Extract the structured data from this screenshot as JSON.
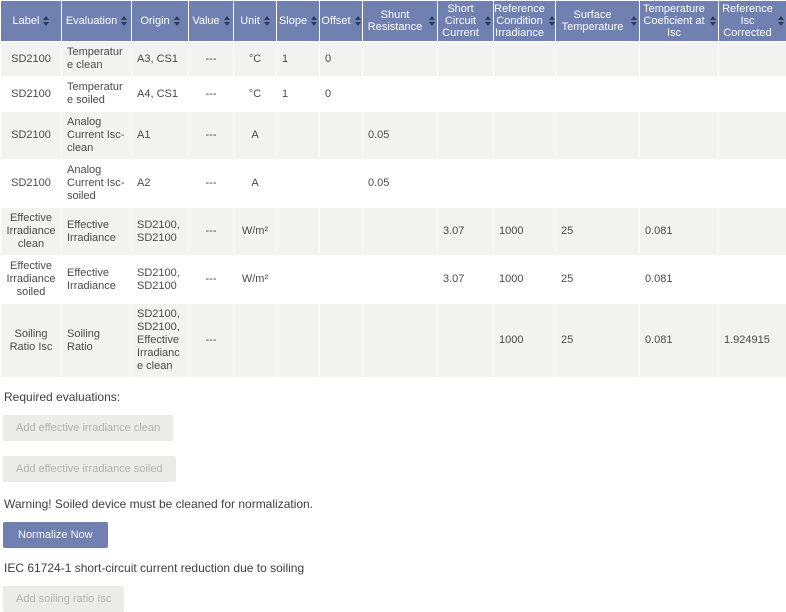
{
  "table": {
    "columns": [
      {
        "key": "label",
        "label": "Label"
      },
      {
        "key": "evaluation",
        "label": "Evaluation"
      },
      {
        "key": "origin",
        "label": "Origin"
      },
      {
        "key": "value",
        "label": "Value"
      },
      {
        "key": "unit",
        "label": "Unit"
      },
      {
        "key": "slope",
        "label": "Slope"
      },
      {
        "key": "offset",
        "label": "Offset"
      },
      {
        "key": "shunt_resistance",
        "label": "Shunt Resistance"
      },
      {
        "key": "short_circuit_current",
        "label": "Short Circuit Current"
      },
      {
        "key": "reference_condition_irradiance",
        "label": "Reference Condition Irradiance"
      },
      {
        "key": "surface_temperature",
        "label": "Surface Temperature"
      },
      {
        "key": "temperature_coeficient_at_isc",
        "label": "Temperature Coeficient at Isc"
      },
      {
        "key": "reference_isc_corrected",
        "label": "Reference Isc Corrected"
      }
    ],
    "rows": [
      [
        "SD2100",
        "Temperature clean",
        "A3, CS1",
        "---",
        "°C",
        "1",
        "0",
        "",
        "",
        "",
        "",
        "",
        ""
      ],
      [
        "SD2100",
        "Temperature soiled",
        "A4, CS1",
        "---",
        "°C",
        "1",
        "0",
        "",
        "",
        "",
        "",
        "",
        ""
      ],
      [
        "SD2100",
        "Analog Current Isc-clean",
        "A1",
        "---",
        "A",
        "",
        "",
        "0.05",
        "",
        "",
        "",
        "",
        ""
      ],
      [
        "SD2100",
        "Analog Current Isc-soiled",
        "A2",
        "---",
        "A",
        "",
        "",
        "0.05",
        "",
        "",
        "",
        "",
        ""
      ],
      [
        "Effective Irradiance clean",
        "Effective Irradiance",
        "SD2100, SD2100",
        "---",
        "W/m²",
        "",
        "",
        "",
        "3.07",
        "1000",
        "25",
        "0.081",
        ""
      ],
      [
        "Effective Irradiance soiled",
        "Effective Irradiance",
        "SD2100, SD2100",
        "---",
        "W/m²",
        "",
        "",
        "",
        "3.07",
        "1000",
        "25",
        "0.081",
        ""
      ],
      [
        "Soiling Ratio Isc",
        "Soiling Ratio",
        "SD2100, SD2100, Effective Irradiance clean",
        "---",
        "",
        "",
        "",
        "",
        "",
        "1000",
        "25",
        "0.081",
        "1.924915"
      ]
    ]
  },
  "sections": {
    "required_evaluations_label": "Required evaluations:",
    "warning": "Warning! Soiled device must be cleaned for normalization.",
    "iec": "IEC 61724-1 short-circuit current reduction due to soiling"
  },
  "buttons": {
    "add_clean": "Add effective irradiance clean",
    "add_soiled": "Add effective irradiance soiled",
    "normalize": "Normalize Now",
    "add_soiling": "Add soiling ratio Isc"
  },
  "colors": {
    "header_bg": "#7081b1",
    "header_text": "#fcfdfe",
    "sort_icon": "#2e3a5e",
    "row_alt_bg": "#f2f2f0",
    "row_bg": "#ffffff",
    "body_text": "#4a4a4a",
    "disabled_button_bg": "#ebebe9",
    "disabled_button_text": "#b2b2ad",
    "primary_button_bg": "#7081b1",
    "primary_button_text": "#f7f8fb"
  }
}
